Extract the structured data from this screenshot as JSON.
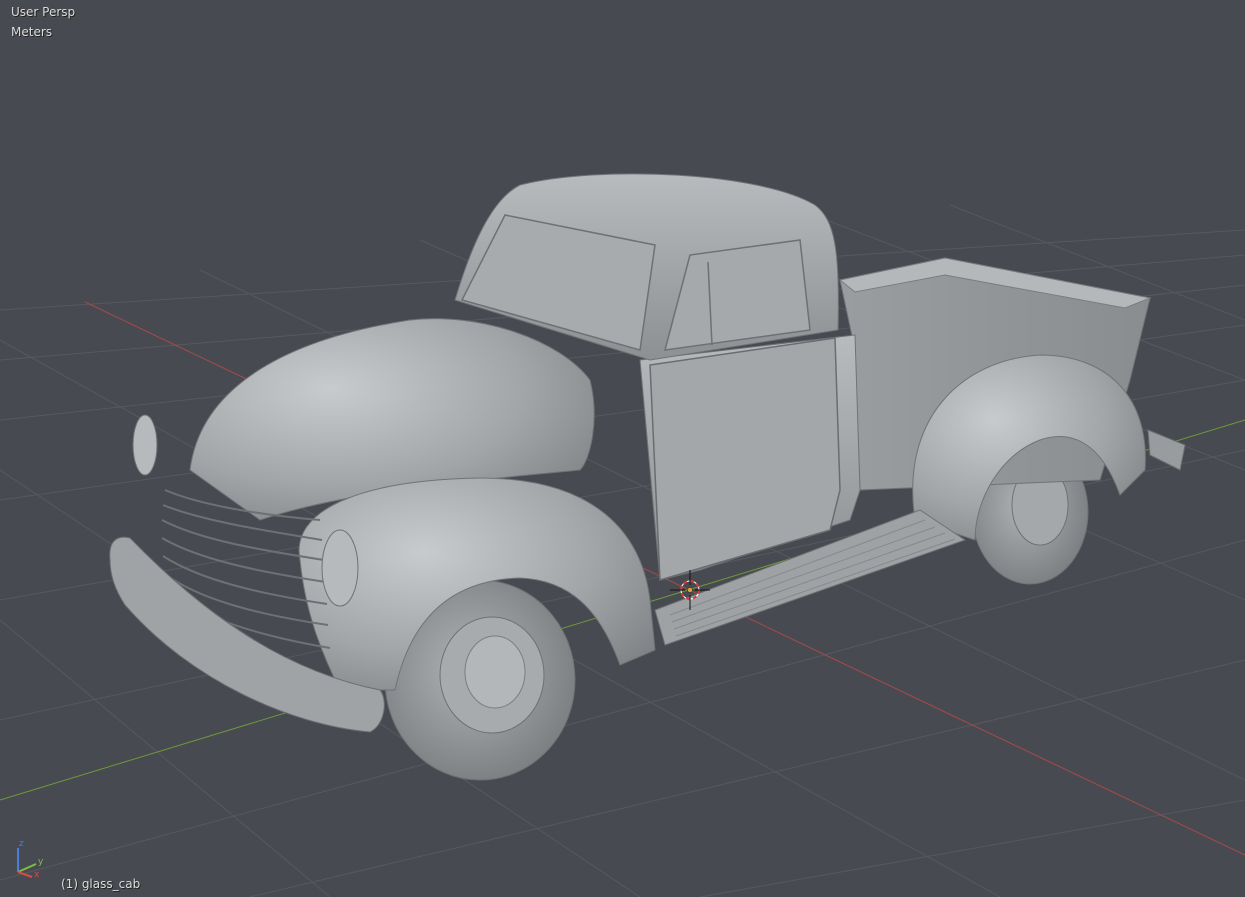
{
  "viewport": {
    "view_name": "User Persp",
    "units": "Meters",
    "active_object": "(1) glass_cab"
  },
  "axis_gizmo": {
    "labels": [
      "z",
      "y",
      "x"
    ],
    "colors": {
      "x": "#d84a4a",
      "y": "#7fbf3f",
      "z": "#4a7fd8"
    }
  },
  "colors": {
    "background": "#474a50",
    "grid": "#56595f",
    "x_axis_line": "#a84a4a",
    "y_axis_line": "#6d9a3a",
    "model_base": "#9c9fa2",
    "cursor_red": "#d83a3a"
  },
  "scene": {
    "object_icon": "pickup-truck-icon",
    "cursor_icon": "3d-cursor-icon"
  }
}
